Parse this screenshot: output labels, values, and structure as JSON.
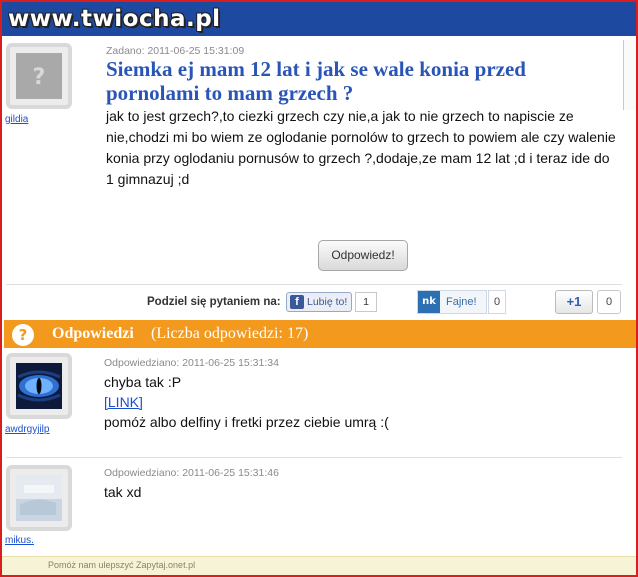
{
  "header": {
    "logo_text": "www.twiocha.pl"
  },
  "question": {
    "asked_label": "Zadano: 2011-06-25 15:31:09",
    "title": "Siemka ej mam 12 lat i jak se wale konia przed pornolami to mam grzech ?",
    "body": "jak to jest grzech?,to ciezki grzech czy nie,a jak to nie grzech to napiscie ze nie,chodzi mi bo wiem ze oglodanie pornolów to grzech to powiem ale czy walenie konia przy oglodaniu pornusów to grzech ?,dodaje,ze mam 12 lat ;d i teraz ide do 1 gimnazuj ;d",
    "user": "gildia",
    "answer_button": "Odpowiedz!"
  },
  "share": {
    "label": "Podziel się pytaniem na:",
    "facebook_label": "Lubię to!",
    "facebook_count": "1",
    "nk_icon": "nk",
    "nk_label": "Fajne!",
    "nk_count": "0",
    "gplus_label": "+1",
    "gplus_count": "0"
  },
  "answers_section": {
    "icon": "?",
    "heading": "Odpowiedzi",
    "count_label": "(Liczba odpowiedzi: 17)"
  },
  "answers": [
    {
      "user": "awdrgyjilp",
      "date_label": "Odpowiedziano: 2011-06-25 15:31:34",
      "line1": "chyba tak :P",
      "link": "[LINK]",
      "line2": "pomóż albo delfiny i fretki przez ciebie umrą :("
    },
    {
      "user": "mikus.",
      "date_label": "Odpowiedziano: 2011-06-25 15:31:46",
      "line1": "tak xd"
    }
  ],
  "footer": {
    "text": "Pomóż nam ulepszyć Zapytaj.onet.pl"
  },
  "colors": {
    "header_blue": "#1d4aa0",
    "title_blue": "#2a55b8",
    "answers_orange": "#f39a1e",
    "link_blue": "#1a4fd0",
    "frame_red": "#d81e1e"
  }
}
